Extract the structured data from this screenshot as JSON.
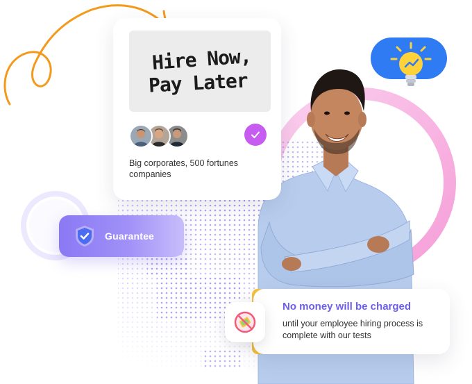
{
  "hire_card": {
    "headline_line1": "Hire Now,",
    "headline_line2": "Pay Later",
    "avatars": [
      "avatar-1",
      "avatar-2",
      "avatar-3"
    ],
    "description": "Big corporates, 500 fortunes companies"
  },
  "guarantee": {
    "label": "Guarantee",
    "icon": "shield-check-icon"
  },
  "money_card": {
    "title": "No money will be charged",
    "body": "until your employee hiring process is complete with our tests",
    "icon": "no-money-icon"
  },
  "bulb": {
    "icon": "lightbulb-icon"
  },
  "colors": {
    "accent_purple": "#6d5ee8",
    "check_purple": "#c65cf0",
    "ring_pink": "#f8b5e2",
    "bulb_blue": "#2f7bf3",
    "arrow_orange": "#f39a1c",
    "accent_yellow": "#f6c23c"
  }
}
